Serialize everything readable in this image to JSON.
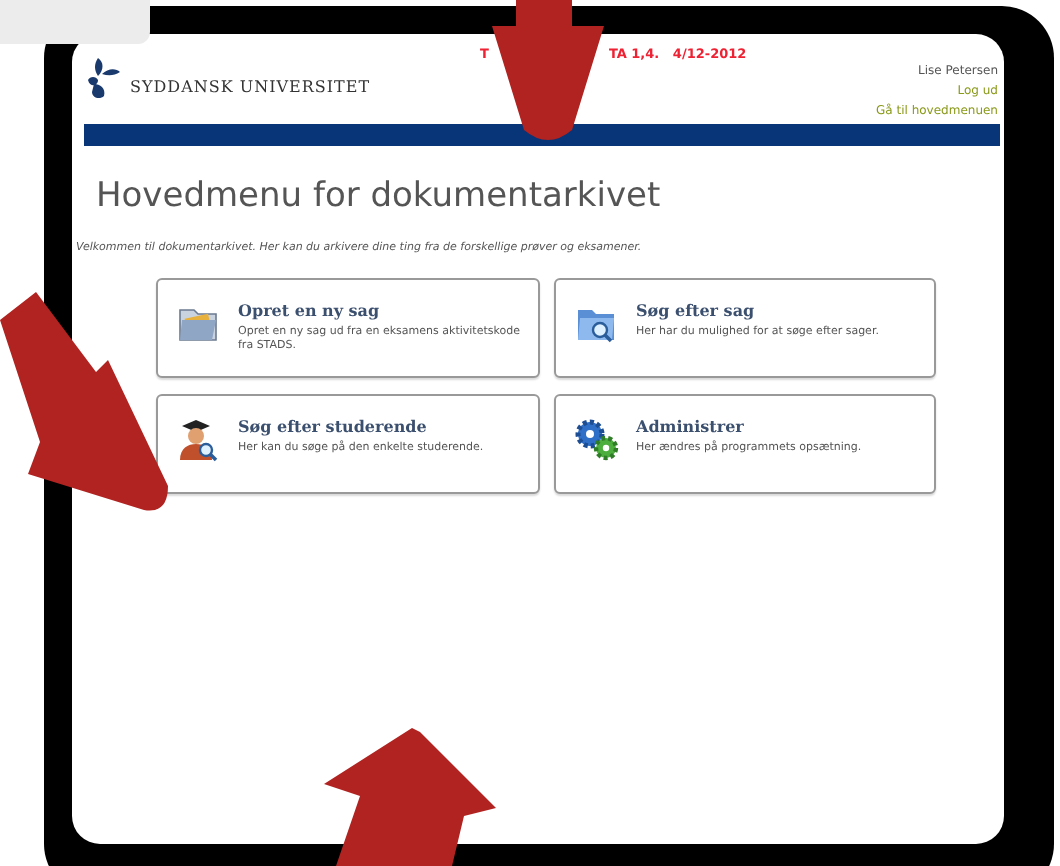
{
  "banner": {
    "parts": [
      "T",
      "TA 1,4.   4/12-2012"
    ]
  },
  "logo": {
    "name": "SYDDANSK UNIVERSITET"
  },
  "user": {
    "name": "Lise Petersen",
    "links": [
      "Log ud",
      "Gå til hovedmenuen"
    ]
  },
  "title": "Hovedmenu for dokumentarkivet",
  "intro": "Velkommen til dokumentarkivet. Her kan du arkivere dine ting fra de forskellige prøver og eksamener.",
  "cards": [
    {
      "kind": "folder",
      "title": "Opret en ny sag",
      "description": "Opret en ny sag ud fra en eksamens aktivitetskode fra STADS."
    },
    {
      "kind": "search-folder",
      "title": "Søg efter sag",
      "description": "Her har du mulighed for at søge efter sager."
    },
    {
      "kind": "student",
      "title": "Søg efter studerende",
      "description": "Her kan du søge på den enkelte studerende."
    },
    {
      "kind": "gears",
      "title": "Administrer",
      "description": "Her ændres på programmets opsætning."
    }
  ]
}
